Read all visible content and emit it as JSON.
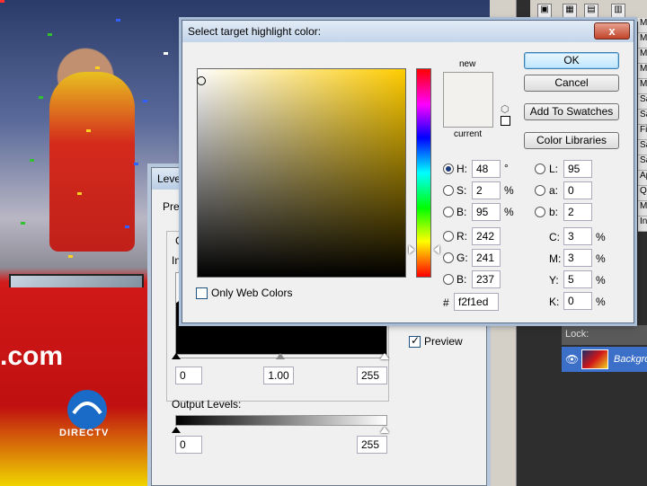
{
  "colors": {
    "new": "#f2f1ed",
    "current": "#f2f1ed",
    "accent": "#3c7fb1"
  },
  "picker": {
    "title": "Select target highlight color:",
    "close_glyph": "x",
    "new_label": "new",
    "current_label": "current",
    "buttons": {
      "ok": "OK",
      "cancel": "Cancel",
      "add_swatches": "Add To Swatches",
      "color_libraries": "Color Libraries"
    },
    "only_web_colors": "Only Web Colors",
    "hsb": {
      "h": {
        "label": "H:",
        "value": "48",
        "unit": "°"
      },
      "s": {
        "label": "S:",
        "value": "2",
        "unit": "%"
      },
      "b": {
        "label": "B:",
        "value": "95",
        "unit": "%"
      }
    },
    "rgb": {
      "r": {
        "label": "R:",
        "value": "242"
      },
      "g": {
        "label": "G:",
        "value": "241"
      },
      "b": {
        "label": "B:",
        "value": "237"
      }
    },
    "lab": {
      "l": {
        "label": "L:",
        "value": "95"
      },
      "a": {
        "label": "a:",
        "value": "0"
      },
      "b": {
        "label": "b:",
        "value": "2"
      }
    },
    "cmyk": {
      "c": {
        "label": "C:",
        "value": "3",
        "unit": "%"
      },
      "m": {
        "label": "M:",
        "value": "3",
        "unit": "%"
      },
      "y": {
        "label": "Y:",
        "value": "5",
        "unit": "%"
      },
      "k": {
        "label": "K:",
        "value": "0",
        "unit": "%"
      }
    },
    "hex_label": "#",
    "hex": "f2f1ed"
  },
  "levels": {
    "title": "Levels",
    "preset_label": "Pre",
    "channel_label": "C",
    "input_label": "In",
    "input_values": {
      "black": "0",
      "gamma": "1.00",
      "white": "255"
    },
    "output_label": "Output Levels:",
    "output_values": {
      "black": "0",
      "white": "255"
    },
    "preview_label": "Preview"
  },
  "photo": {
    "com_text": ".com",
    "directv_text": "DIRECTV"
  },
  "layers": {
    "lock_label": "Lock:",
    "layer_name": "Backgro"
  },
  "side_items": [
    "M",
    "M",
    "M",
    "M",
    "M",
    "Sa",
    "Sa",
    "Fil",
    "Sa",
    "Sa",
    "Ap",
    "Q",
    "M",
    "In"
  ]
}
